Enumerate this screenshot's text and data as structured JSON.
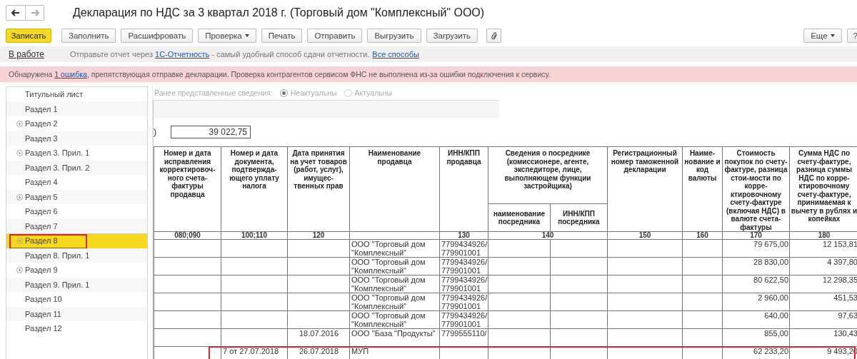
{
  "navigation": [
    {
      "kind": "back",
      "disabled": false
    },
    {
      "kind": "forward",
      "disabled": true
    }
  ],
  "window": {
    "title": "Декларация по НДС за 3 квартал 2018 г. (Торговый дом \"Комплексный\" ООО)"
  },
  "toolbar": [
    {
      "kind": "primary",
      "label": "Записать"
    },
    {
      "kind": "plain",
      "label": "Заполнить"
    },
    {
      "kind": "plain",
      "label": "Расшифровать"
    },
    {
      "kind": "dropdown",
      "label": "Проверка"
    },
    {
      "kind": "plain",
      "label": "Печать"
    },
    {
      "kind": "plain",
      "label": "Отправить"
    },
    {
      "kind": "plain",
      "label": "Выгрузить"
    },
    {
      "kind": "plain",
      "label": "Загрузить"
    },
    {
      "kind": "attach"
    }
  ],
  "toolbar_right": [
    {
      "kind": "dropdown",
      "label": "Еще"
    },
    {
      "kind": "plain",
      "label": "?"
    }
  ],
  "status_bar": {
    "state": "В работе",
    "before": "Отправьте отчет через ",
    "link": "1С-Отчетность",
    "after": " - самый удобный способ сдачи отчетности.",
    "more_link": "Все способы"
  },
  "error_bar": {
    "before": "Обнаружена ",
    "link": "1 ошибка",
    "after": ", препятствующая отправке декларации. Проверка контрагентов сервисом ФНС не выполнена из-за ошибки подключения к сервису."
  },
  "sections": [
    {
      "label": "Титульный лист",
      "expandable": false,
      "selected": false,
      "highlighted": false
    },
    {
      "label": "Раздел 1",
      "expandable": false,
      "selected": false,
      "highlighted": false
    },
    {
      "label": "Раздел 2",
      "expandable": true,
      "selected": false,
      "highlighted": false
    },
    {
      "label": "Раздел 3",
      "expandable": false,
      "selected": false,
      "highlighted": false
    },
    {
      "label": "Раздел 3. Прил. 1",
      "expandable": true,
      "selected": false,
      "highlighted": false
    },
    {
      "label": "Раздел 3. Прил. 2",
      "expandable": false,
      "selected": false,
      "highlighted": false
    },
    {
      "label": "Раздел 4",
      "expandable": false,
      "selected": false,
      "highlighted": false
    },
    {
      "label": "Раздел 5",
      "expandable": true,
      "selected": false,
      "highlighted": false
    },
    {
      "label": "Раздел 6",
      "expandable": false,
      "selected": false,
      "highlighted": false
    },
    {
      "label": "Раздел 7",
      "expandable": false,
      "selected": false,
      "highlighted": false
    },
    {
      "label": "Раздел 8",
      "expandable": true,
      "selected": true,
      "highlighted": true
    },
    {
      "label": "Раздел 8. Прил. 1",
      "expandable": false,
      "selected": false,
      "highlighted": false
    },
    {
      "label": "Раздел 9",
      "expandable": true,
      "selected": false,
      "highlighted": false
    },
    {
      "label": "Раздел 9. Прил. 1",
      "expandable": false,
      "selected": false,
      "highlighted": false
    },
    {
      "label": "Раздел 10",
      "expandable": false,
      "selected": false,
      "highlighted": false
    },
    {
      "label": "Раздел 11",
      "expandable": false,
      "selected": false,
      "highlighted": false
    },
    {
      "label": "Раздел 12",
      "expandable": false,
      "selected": false,
      "highlighted": false
    }
  ],
  "previous_info": {
    "label": "Ранее представленные сведения:",
    "disabled": true,
    "options": [
      {
        "label": "Неактуальны",
        "selected": true
      },
      {
        "label": "Актуальны",
        "selected": false
      }
    ]
  },
  "total": {
    "prefix": ")",
    "value": "39 022,75"
  },
  "table": {
    "columns": [
      {
        "title": "Номер и дата исправления корректировоч-ного счета-фактуры продавца",
        "code": "080;090"
      },
      {
        "title": "Номер и дата документа, подтвержда-ющего уплату налога",
        "code": "100;110"
      },
      {
        "title": "Дата принятия на учет товаров (работ, услуг), имущес-твенных прав",
        "code": "120"
      },
      {
        "title": "Наименование продавца"
      },
      {
        "title": "ИНН/КПП продавца",
        "code": "130"
      },
      {
        "title": "Сведения о посреднике (комиссионере, агенте, экспедиторе, лице, выполняющем функции застройщика)",
        "code": "140",
        "children": [
          {
            "title": "наименование посредника"
          },
          {
            "title": "ИНН/КПП посредника"
          }
        ]
      },
      {
        "title": "Регистрационный номер таможенной декларации",
        "code": "150"
      },
      {
        "title": "Наиме-нование и код валюты",
        "code": "160"
      },
      {
        "title": "Стоимость покупок по счету-фактуре, разница стои-мости по корре-ктировочному счету-фактуре (включая НДС) в валюте счета-фактуры",
        "code": "170"
      },
      {
        "title": "Сумма НДС по счету-фактуре, разница суммы НДС по корре-ктировочному счету-фактуре, принимаемая к вычету в рублях и копейках",
        "code": "180"
      }
    ],
    "rows": [
      {
        "seller": "ООО \"Торговый дом \"Комплексный\"",
        "inn": "7799434926/ 779901001",
        "cost": "79 675,00",
        "vat": "12 153,81",
        "highlighted": false
      },
      {
        "seller": "ООО \"Торговый дом \"Комплексный\"",
        "inn": "7799434926/ 779901001",
        "cost": "28 830,00",
        "vat": "4 397,80",
        "highlighted": false
      },
      {
        "seller": "ООО \"Торговый дом \"Комплексный\"",
        "inn": "7799434926/ 779901001",
        "cost": "80 622,50",
        "vat": "12 298,35",
        "highlighted": false
      },
      {
        "seller": "ООО \"Торговый дом \"Комплексный\"",
        "inn": "7799434926/ 779901001",
        "cost": "2 960,00",
        "vat": "451,53",
        "highlighted": false
      },
      {
        "seller": "ООО \"Торговый дом \"Комплексный\"",
        "inn": "7799434926/ 779901001",
        "cost": "640,00",
        "vat": "97,63",
        "highlighted": false
      },
      {
        "date": "18.07.2016",
        "seller": "ООО \"База \"Продукты\"",
        "inn": "7799555110/",
        "cost": "855,00",
        "vat": "130,43",
        "highlighted": false
      },
      {
        "document": "7 от 27.07.2018",
        "date": "26.07.2018",
        "seller": "МУП",
        "cost": "62 233,20",
        "vat": "9 493,20",
        "highlighted": true
      }
    ]
  }
}
